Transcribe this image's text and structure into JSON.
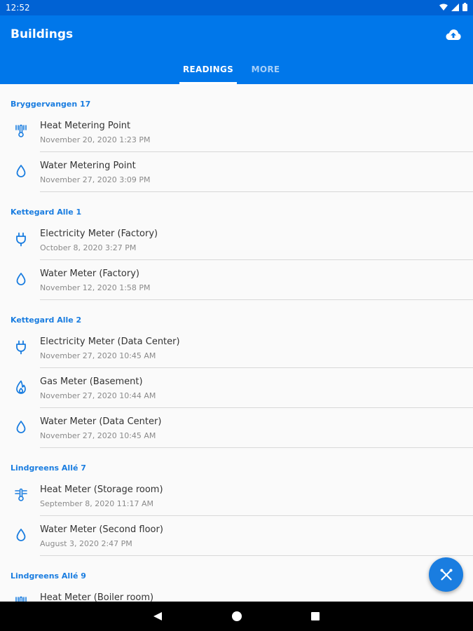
{
  "status_bar": {
    "time": "12:52"
  },
  "app_bar": {
    "title": "Buildings"
  },
  "tabs": [
    {
      "label": "READINGS",
      "active": true
    },
    {
      "label": "MORE",
      "active": false
    }
  ],
  "buildings": [
    {
      "name": "Bryggervangen 17",
      "meters": [
        {
          "name": "Heat Metering Point",
          "date": "November 20, 2020 1:23 PM",
          "icon": "heat"
        },
        {
          "name": "Water Metering Point",
          "date": "November 27, 2020 3:09 PM",
          "icon": "water"
        }
      ]
    },
    {
      "name": "Kettegard Alle 1",
      "meters": [
        {
          "name": "Electricity Meter (Factory)",
          "date": "October 8, 2020 3:27 PM",
          "icon": "electricity"
        },
        {
          "name": "Water Meter (Factory)",
          "date": "November 12, 2020 1:58 PM",
          "icon": "water"
        }
      ]
    },
    {
      "name": "Kettegard Alle 2",
      "meters": [
        {
          "name": "Electricity Meter (Data Center)",
          "date": "November 27, 2020 10:45 AM",
          "icon": "electricity"
        },
        {
          "name": "Gas Meter (Basement)",
          "date": "November 27, 2020 10:44 AM",
          "icon": "gas"
        },
        {
          "name": "Water Meter (Data Center)",
          "date": "November 27, 2020 10:45 AM",
          "icon": "water"
        }
      ]
    },
    {
      "name": "Lindgreens Allé 7",
      "meters": [
        {
          "name": "Heat Meter (Storage room)",
          "date": "September 8, 2020 11:17 AM",
          "icon": "heat"
        },
        {
          "name": "Water Meter (Second floor)",
          "date": "August 3, 2020 2:47 PM",
          "icon": "water"
        }
      ]
    },
    {
      "name": "Lindgreens Allé 9",
      "meters": [
        {
          "name": "Heat Meter (Boiler room)",
          "date": "",
          "icon": "heat"
        }
      ]
    }
  ],
  "colors": {
    "primary": "#0077ea",
    "status_bar": "#0062d4",
    "accent": "#1a7de0"
  }
}
